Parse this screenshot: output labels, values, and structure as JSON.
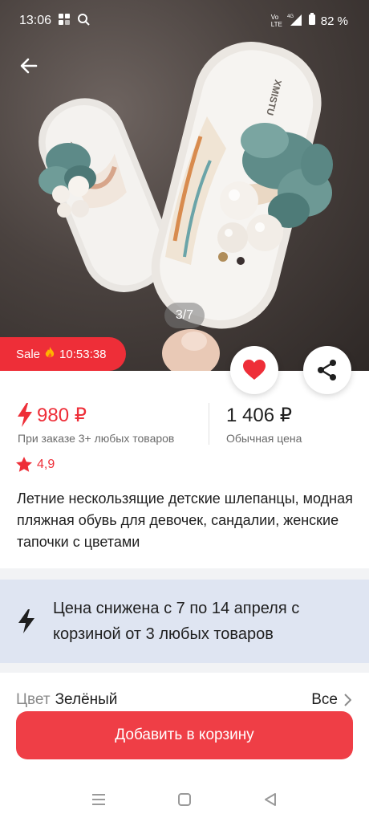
{
  "status_bar": {
    "time": "13:06",
    "battery": "82 %",
    "network": "4G",
    "volte": "Vo LTE"
  },
  "gallery": {
    "counter": "3/7",
    "sale_label": "Sale",
    "sale_timer": "10:53:38",
    "shoe_brand_text": "XMISTU"
  },
  "price": {
    "bulk_price": "980 ₽",
    "bulk_note": "При заказе 3+ любых товаров",
    "regular_price": "1 406 ₽",
    "regular_note": "Обычная цена"
  },
  "rating": {
    "value": "4,9"
  },
  "product": {
    "title": "Летние нескользящие детские шлепанцы, модная пляжная обувь для девочек, сандалии, женские тапочки с цветами"
  },
  "promo": {
    "text": "Цена снижена с 7 по 14 апреля с корзиной от 3 любых товаров"
  },
  "variant": {
    "label": "Цвет",
    "value": "Зелёный",
    "all_link": "Все"
  },
  "actions": {
    "add_to_cart": "Добавить в корзину"
  },
  "colors": {
    "accent": "#ee2e38",
    "promo_bg": "#dfe5f2"
  },
  "icons": {
    "back": "arrow-left-icon",
    "favorite": "heart-icon",
    "share": "share-icon",
    "bolt": "lightning-icon",
    "star": "star-icon",
    "fire": "fire-icon",
    "chevron": "chevron-right-icon",
    "nav": [
      "menu-icon",
      "home-square-icon",
      "back-triangle-icon"
    ]
  }
}
